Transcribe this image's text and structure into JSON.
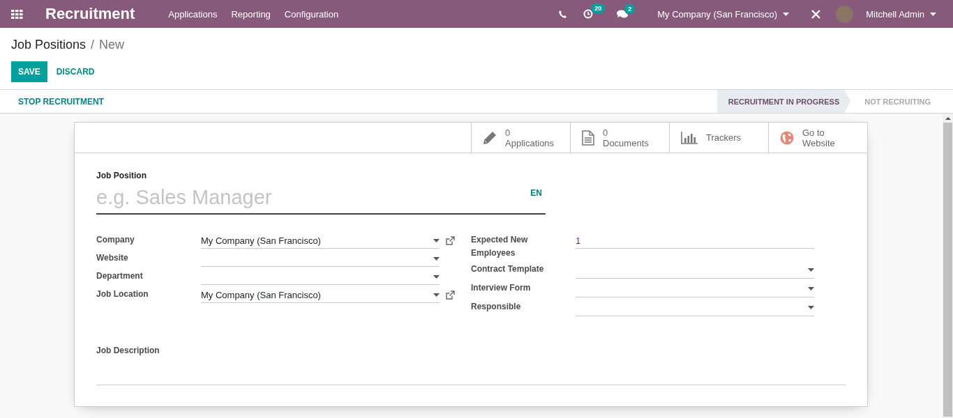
{
  "navbar": {
    "app_title": "Recruitment",
    "menus": [
      "Applications",
      "Reporting",
      "Configuration"
    ],
    "activity_count": "20",
    "message_count": "2",
    "company": "My Company (San Francisco)",
    "user": "Mitchell Admin"
  },
  "breadcrumb": {
    "parent": "Job Positions",
    "separator": "/",
    "current": "New"
  },
  "buttons": {
    "save": "SAVE",
    "discard": "DISCARD"
  },
  "header": {
    "action": "STOP RECRUITMENT",
    "stages": [
      {
        "label": "RECRUITMENT IN PROGRESS",
        "selected": true
      },
      {
        "label": "NOT RECRUITING",
        "selected": false
      }
    ]
  },
  "smart_buttons": [
    {
      "kind": "pencil",
      "count": "0",
      "label": "Applications"
    },
    {
      "kind": "document",
      "count": "0",
      "label": "Documents"
    },
    {
      "kind": "chart",
      "label": "Trackers"
    },
    {
      "kind": "globe",
      "label": "Go to Website"
    }
  ],
  "job_position": {
    "label": "Job Position",
    "placeholder": "e.g. Sales Manager",
    "language": "EN"
  },
  "left_fields": [
    {
      "label": "Company",
      "value": "My Company (San Francisco)",
      "external_link": true
    },
    {
      "label": "Website",
      "external_link": false
    },
    {
      "label": "Department",
      "external_link": false
    },
    {
      "label": "Job Location",
      "value": "My Company (San Francisco)",
      "external_link": true
    }
  ],
  "right_fields": [
    {
      "label": "Expected New Employees",
      "kind": "text",
      "value": "1"
    },
    {
      "label": "Contract Template",
      "kind": "select"
    },
    {
      "label": "Interview Form",
      "kind": "select"
    },
    {
      "label": "Responsible",
      "kind": "select"
    }
  ],
  "job_description": {
    "label": "Job Description"
  }
}
